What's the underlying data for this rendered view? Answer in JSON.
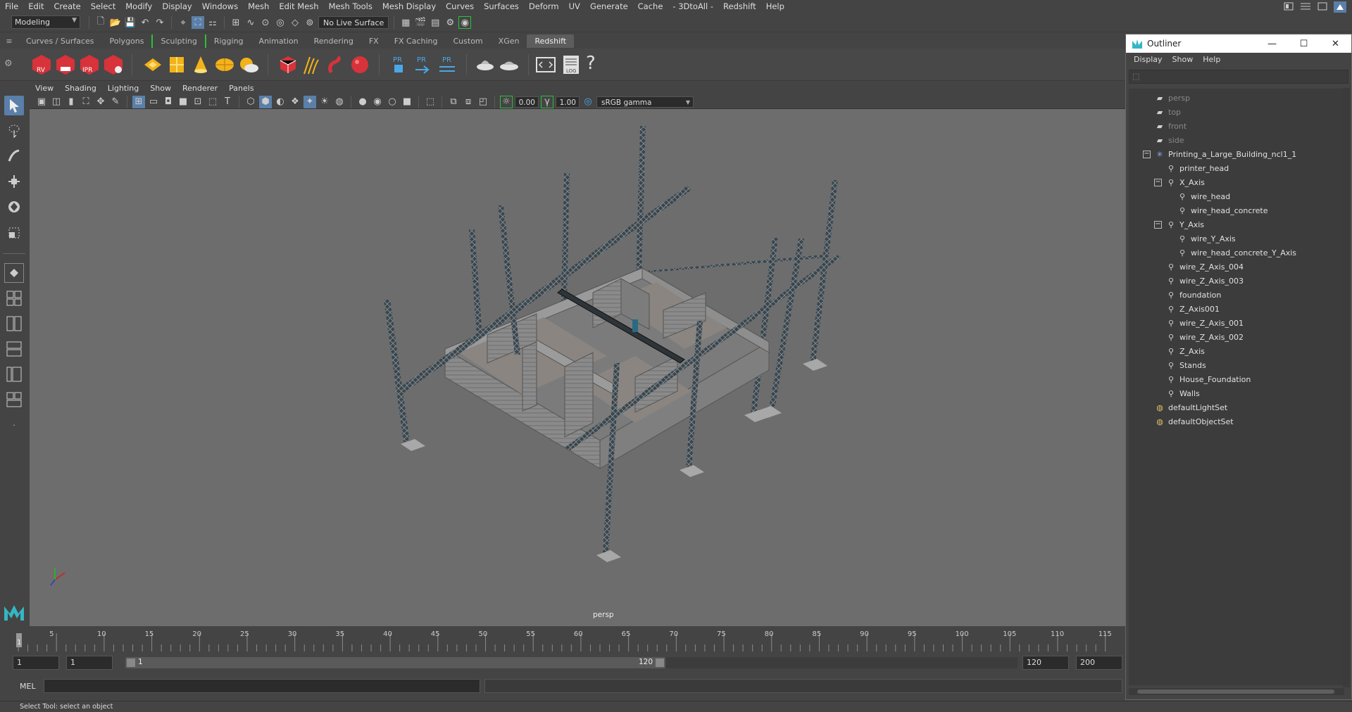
{
  "menubar": {
    "items": [
      "File",
      "Edit",
      "Create",
      "Select",
      "Modify",
      "Display",
      "Windows",
      "Mesh",
      "Edit Mesh",
      "Mesh Tools",
      "Mesh Display",
      "Curves",
      "Surfaces",
      "Deform",
      "UV",
      "Generate",
      "Cache",
      "- 3DtoAll -",
      "Redshift",
      "Help"
    ]
  },
  "statusline": {
    "mode": "Modeling",
    "live_surface": "No Live Surface"
  },
  "shelf": {
    "tabs": [
      "Curves / Surfaces",
      "Polygons",
      "Sculpting",
      "Rigging",
      "Animation",
      "Rendering",
      "FX",
      "FX Caching",
      "Custom",
      "XGen",
      "Redshift"
    ],
    "active_tab": "Redshift",
    "icon_labels": {
      "rv": "RV",
      "ipr": "IPR",
      "pr": "PR",
      "log": "LOG",
      "help": "?"
    }
  },
  "viewport": {
    "menus": [
      "View",
      "Shading",
      "Lighting",
      "Show",
      "Renderer",
      "Panels"
    ],
    "exposure": "0.00",
    "gamma": "1.00",
    "color_space": "sRGB gamma",
    "camera": "persp"
  },
  "timeslider": {
    "current_frame": "1",
    "ticks": [
      "5",
      "10",
      "15",
      "20",
      "25",
      "30",
      "35",
      "40",
      "45",
      "50",
      "55",
      "60",
      "65",
      "70",
      "75",
      "80",
      "85",
      "90",
      "95",
      "100",
      "105",
      "110",
      "115"
    ]
  },
  "range": {
    "start": "1",
    "start2": "1",
    "slider_start": "1",
    "slider_end": "120",
    "end": "120",
    "end2": "200"
  },
  "cmdline": {
    "label": "MEL"
  },
  "helpline": {
    "text": "Select Tool: select an object"
  },
  "outliner": {
    "title": "Outliner",
    "menus": [
      "Display",
      "Show",
      "Help"
    ],
    "items": [
      {
        "label": "persp",
        "dim": true,
        "icon": "camera-icon"
      },
      {
        "label": "top",
        "dim": true,
        "icon": "camera-icon"
      },
      {
        "label": "front",
        "dim": true,
        "icon": "camera-icon"
      },
      {
        "label": "side",
        "dim": true,
        "icon": "camera-icon"
      },
      {
        "label": "Printing_a_Large_Building_ncl1_1",
        "icon": "asterisk-icon"
      },
      {
        "label": "printer_head",
        "icon": "transform-icon"
      },
      {
        "label": "X_Axis",
        "icon": "transform-icon"
      },
      {
        "label": "wire_head",
        "icon": "transform-icon"
      },
      {
        "label": "wire_head_concrete",
        "icon": "transform-icon"
      },
      {
        "label": "Y_Axis",
        "icon": "transform-icon"
      },
      {
        "label": "wire_Y_Axis",
        "icon": "transform-icon"
      },
      {
        "label": "wire_head_concrete_Y_Axis",
        "icon": "transform-icon"
      },
      {
        "label": "wire_Z_Axis_004",
        "icon": "transform-icon"
      },
      {
        "label": "wire_Z_Axis_003",
        "icon": "transform-icon"
      },
      {
        "label": "foundation",
        "icon": "transform-icon"
      },
      {
        "label": "Z_Axis001",
        "icon": "transform-icon"
      },
      {
        "label": "wire_Z_Axis_001",
        "icon": "transform-icon"
      },
      {
        "label": "wire_Z_Axis_002",
        "icon": "transform-icon"
      },
      {
        "label": "Z_Axis",
        "icon": "transform-icon"
      },
      {
        "label": "Stands",
        "icon": "transform-icon"
      },
      {
        "label": "House_Foundation",
        "icon": "transform-icon"
      },
      {
        "label": "Walls",
        "icon": "transform-icon"
      },
      {
        "label": "defaultLightSet",
        "icon": "set-icon"
      },
      {
        "label": "defaultObjectSet",
        "icon": "set-icon"
      }
    ]
  },
  "colors": {
    "accent": "#5a7fa8",
    "redshift_red": "#d8323a",
    "shelf_bracket": "#2ac03a",
    "axis_x": "#d02020",
    "axis_y": "#20c020",
    "axis_z": "#2040d0"
  }
}
